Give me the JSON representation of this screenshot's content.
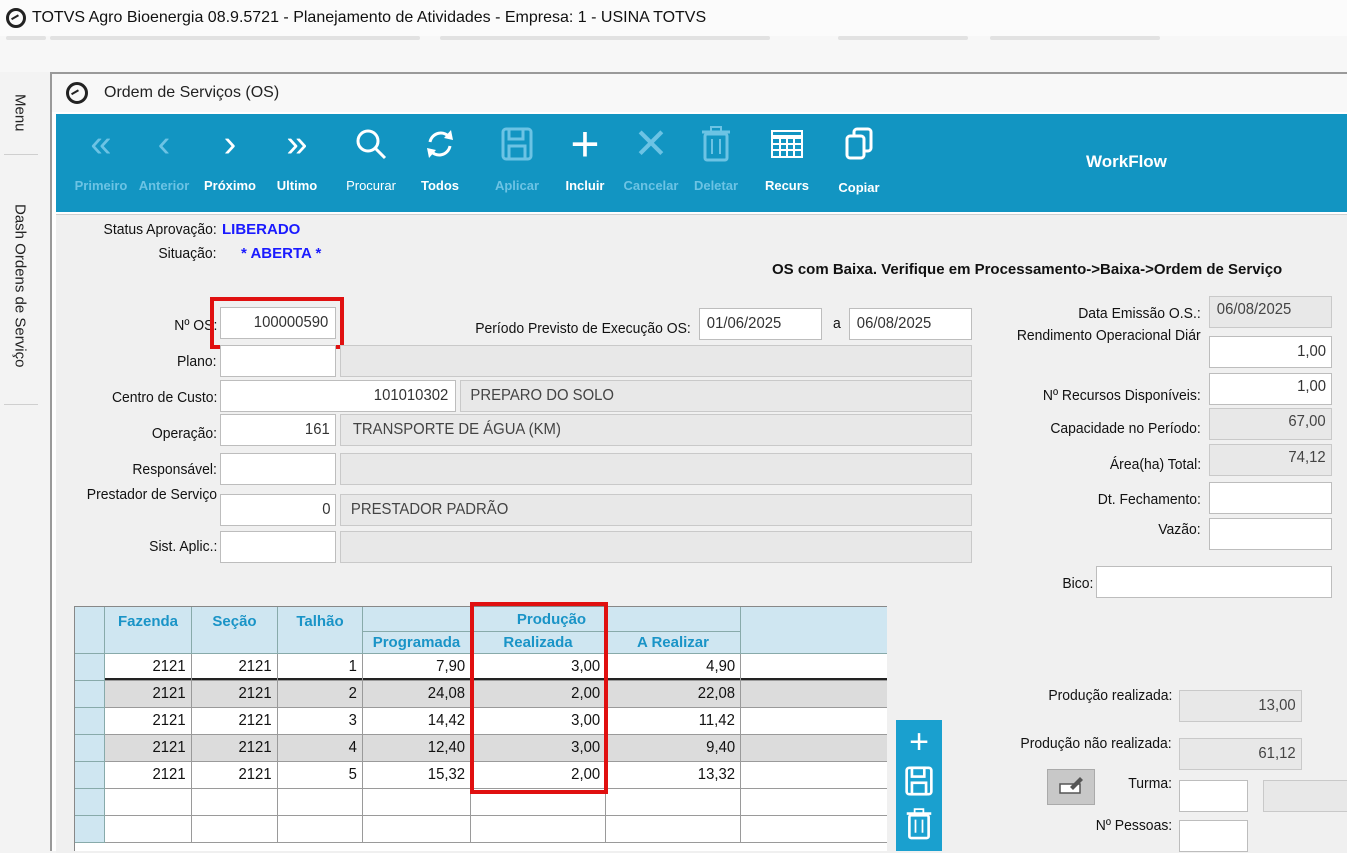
{
  "window": {
    "title": "TOTVS Agro Bioenergia 08.9.5721 - Planejamento de Atividades  - Empresa: 1 - USINA TOTVS"
  },
  "rail": {
    "menu": "Menu",
    "dash": "Dash Ordens de Serviço"
  },
  "form": {
    "title": "Ordem de Serviços (OS)"
  },
  "toolbar": {
    "first": "Primeiro",
    "prev": "Anterior",
    "next": "Próximo",
    "last": "Ultimo",
    "search": "Procurar",
    "all": "Todos",
    "apply": "Aplicar",
    "include": "Incluir",
    "cancel": "Cancelar",
    "delete": "Deletar",
    "resources": "Recurs",
    "copy": "Copiar",
    "workflow": "WorkFlow"
  },
  "status": {
    "approval_label": "Status Aprovação:",
    "approval_value": "LIBERADO",
    "situation_label": "Situação:",
    "situation_value": "* ABERTA *"
  },
  "warning": "OS com Baixa. Verifique em Processamento->Baixa->Ordem de Serviço",
  "fields": {
    "os_label": "Nº OS:",
    "os_value": "100000590",
    "period_label": "Período Previsto de Execução OS:",
    "period_start": "01/06/2025",
    "period_sep": "a",
    "period_end": "06/08/2025",
    "plano_label": "Plano:",
    "cc_label": "Centro de Custo:",
    "cc_code": "101010302",
    "cc_desc": "PREPARO DO SOLO",
    "op_label": "Operação:",
    "op_code": "161",
    "op_desc": "TRANSPORTE DE ÁGUA (KM)",
    "resp_label": "Responsável:",
    "prest_label": "Prestador de Serviço",
    "prest_code": "0",
    "prest_desc": "PRESTADOR PADRÃO",
    "sist_label": "Sist. Aplic.:",
    "emissao_label": "Data Emissão O.S.:",
    "emissao_value": "06/08/2025",
    "rend_label": "Rendimento Operacional Diár",
    "rend_value": "1,00",
    "recursos_label": "Nº Recursos Disponíveis:",
    "recursos_value": "1,00",
    "cap_label": "Capacidade no Período:",
    "cap_value": "67,00",
    "area_label": "Área(ha) Total:",
    "area_value": "74,12",
    "fech_label": "Dt. Fechamento:",
    "vazao_label": "Vazão:",
    "bico_label": "Bico:",
    "prod_real_label": "Produção realizada:",
    "prod_real_value": "13,00",
    "prod_nreal_label": "Produção não realizada:",
    "prod_nreal_value": "61,12",
    "turma_label": "Turma:",
    "pessoas_label": "Nº Pessoas:"
  },
  "grid": {
    "headers": {
      "fazenda": "Fazenda",
      "secao": "Seção",
      "talhao": "Talhão",
      "producao": "Produção",
      "programada": "Programada",
      "realizada": "Realizada",
      "a_realizar": "A Realizar"
    },
    "rows": [
      [
        "2121",
        "2121",
        "1",
        "7,90",
        "3,00",
        "4,90"
      ],
      [
        "2121",
        "2121",
        "2",
        "24,08",
        "2,00",
        "22,08"
      ],
      [
        "2121",
        "2121",
        "3",
        "14,42",
        "3,00",
        "11,42"
      ],
      [
        "2121",
        "2121",
        "4",
        "12,40",
        "3,00",
        "9,40"
      ],
      [
        "2121",
        "2121",
        "5",
        "15,32",
        "2,00",
        "13,32"
      ]
    ]
  }
}
